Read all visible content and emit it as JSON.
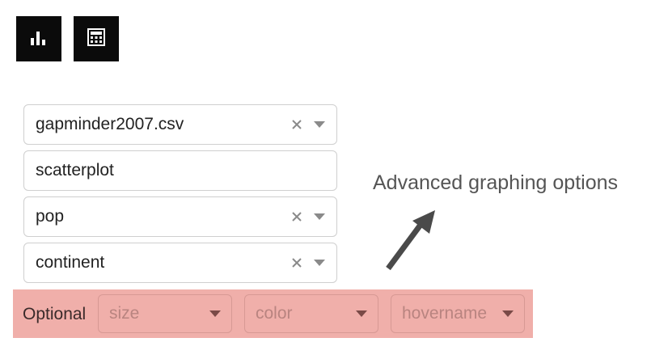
{
  "toolbar": {
    "chart_icon": "bar-chart-icon",
    "calculator_icon": "calculator-icon"
  },
  "form": {
    "dataset": {
      "value": "gapminder2007.csv",
      "clearable": true
    },
    "plot_type": {
      "value": "scatterplot"
    },
    "x_axis": {
      "value": "pop",
      "clearable": true
    },
    "y_axis": {
      "value": "continent",
      "clearable": true
    }
  },
  "optional": {
    "label": "Optional",
    "fields": [
      {
        "placeholder": "size"
      },
      {
        "placeholder": "color"
      },
      {
        "placeholder": "hovername"
      }
    ]
  },
  "annotation": {
    "text": "Advanced graphing options"
  },
  "colors": {
    "icon_button_bg": "#0b0b0b",
    "optional_bar_bg": "#f0afaa",
    "annotation_text": "#555555",
    "arrow": "#4a4a4a"
  }
}
